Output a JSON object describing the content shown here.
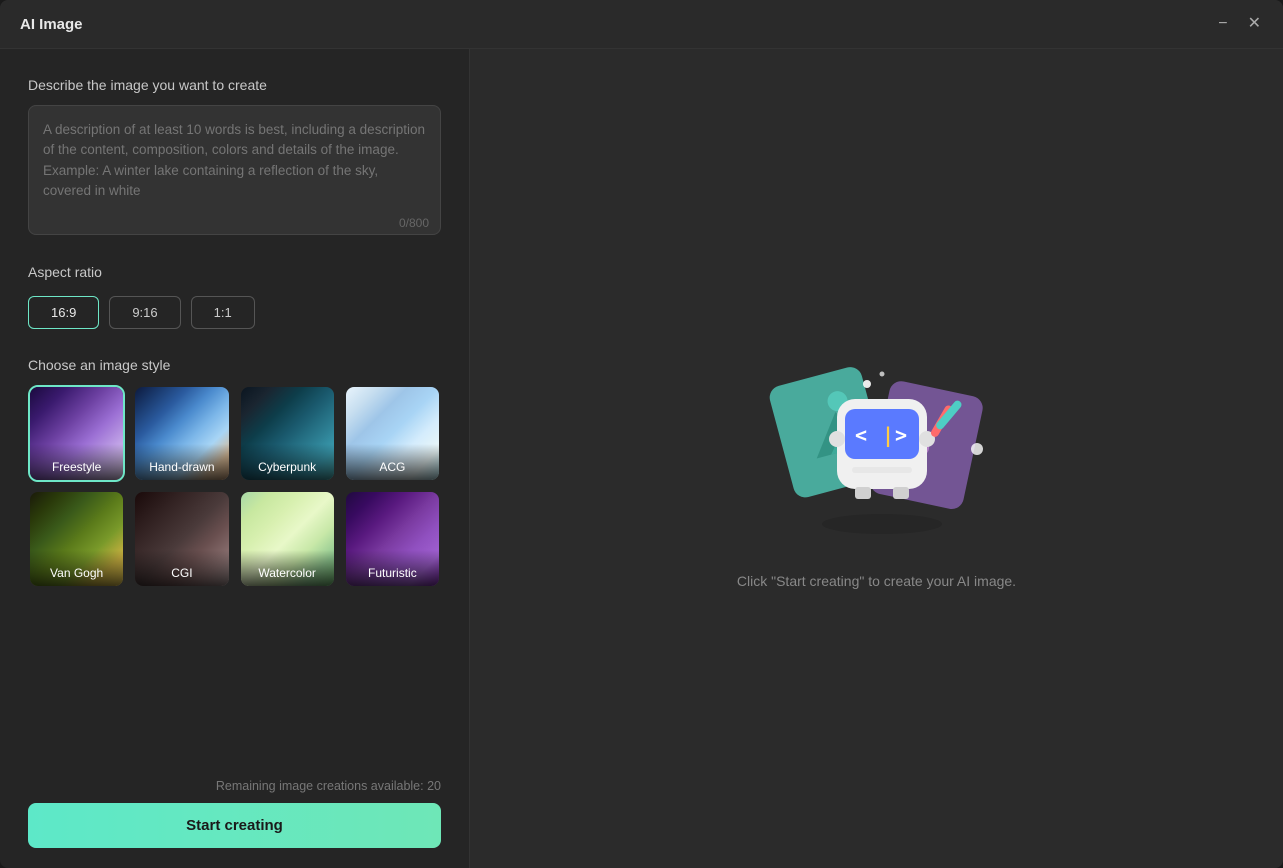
{
  "window": {
    "title": "AI Image"
  },
  "titlebar": {
    "minimize_label": "−",
    "close_label": "✕"
  },
  "left": {
    "describe_label": "Describe the image you want to create",
    "prompt_placeholder": "A description of at least 10 words is best, including a description of the content, composition, colors and details of the image. Example: A winter lake containing a reflection of the sky, covered in white",
    "char_count": "0/800",
    "aspect_ratio_label": "Aspect ratio",
    "aspect_options": [
      {
        "label": "16:9",
        "active": true
      },
      {
        "label": "9:16",
        "active": false
      },
      {
        "label": "1:1",
        "active": false
      }
    ],
    "style_label": "Choose an image style",
    "styles": [
      {
        "id": "freestyle",
        "label": "Freestyle",
        "selected": true,
        "thumb_class": "thumb-freestyle"
      },
      {
        "id": "handdrawn",
        "label": "Hand-drawn",
        "selected": false,
        "thumb_class": "thumb-handdrawn"
      },
      {
        "id": "cyberpunk",
        "label": "Cyberpunk",
        "selected": false,
        "thumb_class": "thumb-cyberpunk"
      },
      {
        "id": "acg",
        "label": "ACG",
        "selected": false,
        "thumb_class": "thumb-acg"
      },
      {
        "id": "vangogh",
        "label": "Van Gogh",
        "selected": false,
        "thumb_class": "thumb-vangogh"
      },
      {
        "id": "cgi",
        "label": "CGI",
        "selected": false,
        "thumb_class": "thumb-cgi"
      },
      {
        "id": "watercolor",
        "label": "Watercolor",
        "selected": false,
        "thumb_class": "thumb-watercolor"
      },
      {
        "id": "futuristic",
        "label": "Futuristic",
        "selected": false,
        "thumb_class": "thumb-futuristic"
      }
    ],
    "remaining_text": "Remaining image creations available: 20",
    "start_btn_label": "Start creating"
  },
  "right": {
    "hint_text": "Click \"Start creating\" to create your AI image."
  }
}
